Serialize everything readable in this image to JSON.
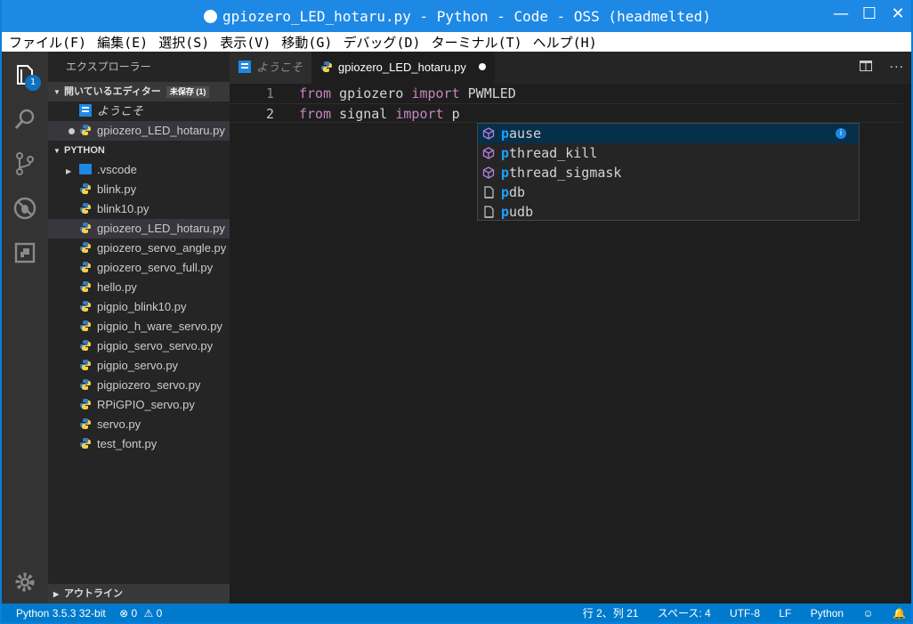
{
  "window": {
    "title": "gpiozero_LED_hotaru.py - Python - Code - OSS (headmelted)",
    "controls": [
      "—",
      "☐",
      "✕"
    ]
  },
  "menu": [
    "ファイル(F)",
    "編集(E)",
    "選択(S)",
    "表示(V)",
    "移動(G)",
    "デバッグ(D)",
    "ターミナル(T)",
    "ヘルプ(H)"
  ],
  "activity": {
    "badge": "1",
    "icons": [
      "explorer-icon",
      "search-icon",
      "source-control-icon",
      "debug-icon",
      "extensions-icon",
      "settings-icon"
    ]
  },
  "sidebar": {
    "title": "エクスプローラー",
    "open_editors": {
      "label": "開いているエディター",
      "unsaved_badge": "未保存 (1)",
      "items": [
        {
          "name": "ようこそ",
          "icon": "welcome-icon"
        },
        {
          "name": "gpiozero_LED_hotaru.py",
          "icon": "python-icon",
          "modified": true
        }
      ]
    },
    "folder": {
      "label": "PYTHON",
      "items": [
        {
          "name": ".vscode",
          "icon": "folder-icon"
        },
        {
          "name": "blink.py"
        },
        {
          "name": "blink10.py"
        },
        {
          "name": "gpiozero_LED_hotaru.py",
          "selected": true
        },
        {
          "name": "gpiozero_servo_angle.py"
        },
        {
          "name": "gpiozero_servo_full.py"
        },
        {
          "name": "hello.py"
        },
        {
          "name": "pigpio_blink10.py"
        },
        {
          "name": "pigpio_h_ware_servo.py"
        },
        {
          "name": "pigpio_servo_servo.py"
        },
        {
          "name": "pigpio_servo.py"
        },
        {
          "name": "pigpiozero_servo.py"
        },
        {
          "name": "RPiGPIO_servo.py"
        },
        {
          "name": "servo.py"
        },
        {
          "name": "test_font.py"
        }
      ]
    },
    "outline": {
      "label": "アウトライン"
    }
  },
  "tabs": [
    {
      "label": "ようこそ",
      "active": false
    },
    {
      "label": "gpiozero_LED_hotaru.py",
      "active": true,
      "modified": true
    }
  ],
  "code": {
    "lines": [
      {
        "num": "1",
        "kw1": "from",
        "mod": " gpiozero ",
        "kw2": "import",
        "rest": " PWMLED"
      },
      {
        "num": "2",
        "kw1": "from",
        "mod": " signal ",
        "kw2": "import",
        "rest": " p"
      }
    ]
  },
  "suggestions": [
    {
      "match": "p",
      "rest": "ause",
      "kind": "module",
      "selected": true
    },
    {
      "match": "p",
      "rest": "thread_kill",
      "kind": "module"
    },
    {
      "match": "p",
      "rest": "thread_sigmask",
      "kind": "module"
    },
    {
      "match": "p",
      "rest": "db",
      "kind": "file"
    },
    {
      "match": "p",
      "rest": "udb",
      "kind": "file"
    }
  ],
  "status": {
    "interpreter": "Python 3.5.3 32-bit",
    "errors": "0",
    "warnings": "0",
    "position": "行 2、列 21",
    "indent": "スペース: 4",
    "encoding": "UTF-8",
    "eol": "LF",
    "language": "Python"
  },
  "colors": {
    "accent": "#007acc",
    "titlebar": "#1e88e5",
    "keyword": "#c586c0",
    "match": "#18a3ff"
  }
}
